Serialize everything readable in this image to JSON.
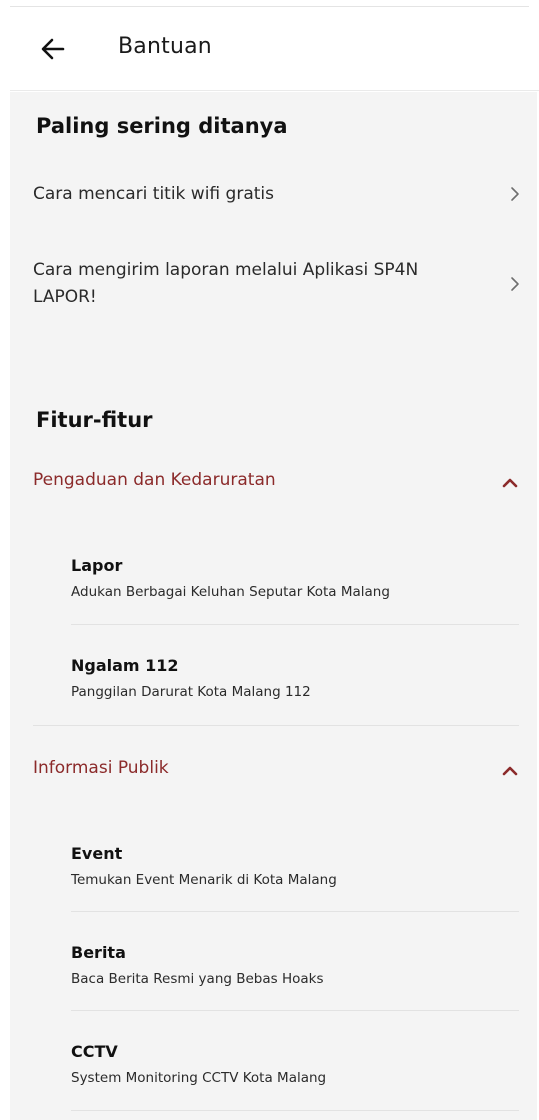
{
  "header": {
    "title": "Bantuan",
    "back_icon": "arrow-left-icon"
  },
  "faq": {
    "heading": "Paling sering ditanya",
    "items": [
      {
        "label": "Cara mencari titik wifi gratis"
      },
      {
        "label": "Cara mengirim laporan melalui Aplikasi SP4N LAPOR!"
      }
    ]
  },
  "features": {
    "heading": "Fitur-fitur",
    "groups": [
      {
        "label": "Pengaduan dan Kedaruratan",
        "expanded": true,
        "items": [
          {
            "name": "Lapor",
            "desc": "Adukan Berbagai Keluhan Seputar Kota Malang"
          },
          {
            "name": "Ngalam 112",
            "desc": "Panggilan Darurat Kota Malang 112"
          }
        ]
      },
      {
        "label": "Informasi Publik",
        "expanded": true,
        "items": [
          {
            "name": "Event",
            "desc": "Temukan Event Menarik di Kota Malang"
          },
          {
            "name": "Berita",
            "desc": "Baca Berita Resmi yang Bebas Hoaks"
          },
          {
            "name": "CCTV",
            "desc": "System Monitoring CCTV Kota Malang"
          }
        ]
      }
    ]
  },
  "colors": {
    "accent": "#8b2a2a",
    "background": "#f4f4f4",
    "appbar": "#ffffff"
  }
}
